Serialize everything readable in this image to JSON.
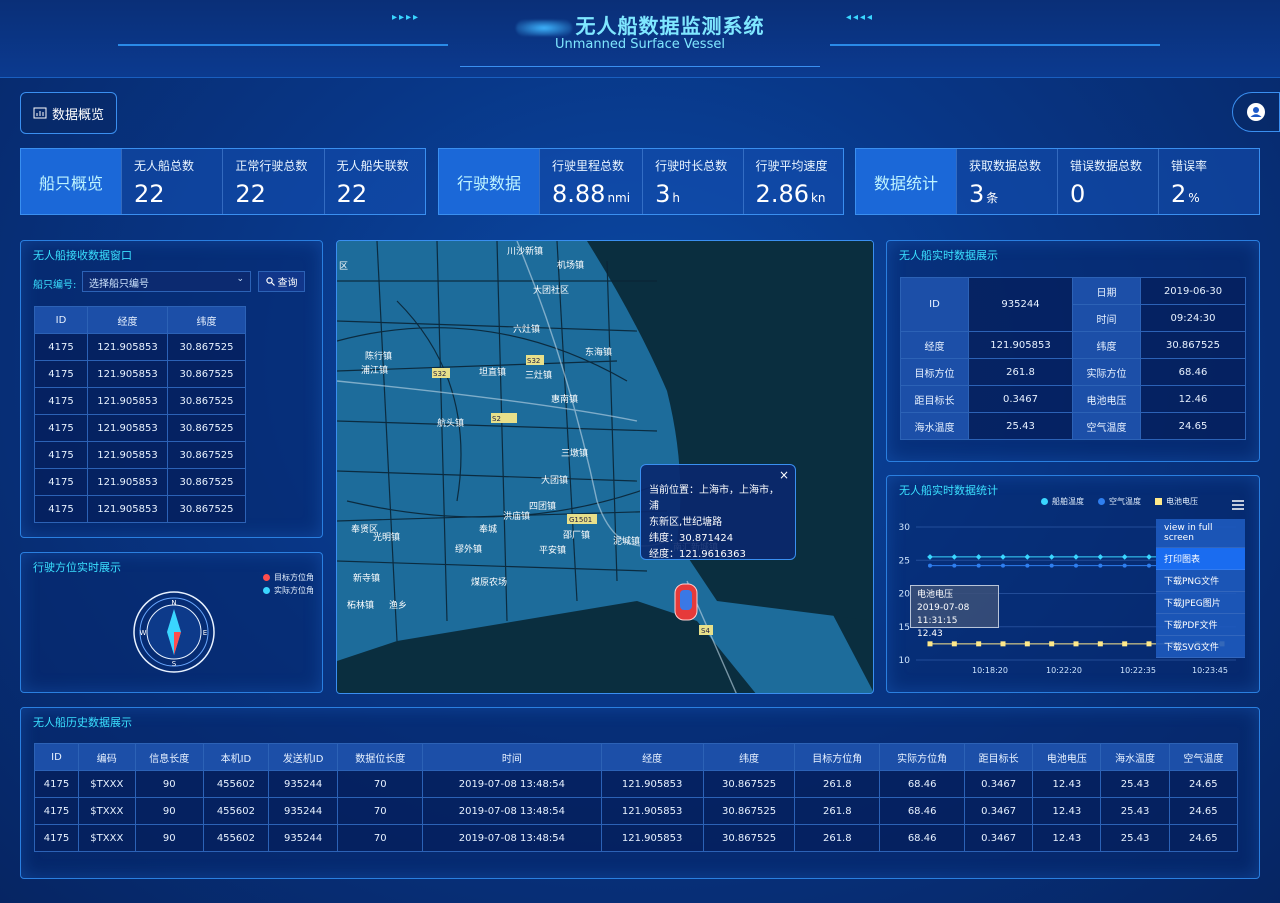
{
  "header": {
    "title": "无人船数据监测系统",
    "subtitle": "Unmanned Surface Vessel",
    "arrows_left": "▸▸▸▸",
    "arrows_right": "◂◂◂◂"
  },
  "nav": {
    "overview_label": "数据概览"
  },
  "stats": [
    {
      "head": "船只概览",
      "cells": [
        {
          "label": "无人船总数",
          "value": "22",
          "unit": ""
        },
        {
          "label": "正常行驶总数",
          "value": "22",
          "unit": ""
        },
        {
          "label": "无人船失联数",
          "value": "22",
          "unit": ""
        }
      ]
    },
    {
      "head": "行驶数据",
      "cells": [
        {
          "label": "行驶里程总数",
          "value": "8.88",
          "unit": "nmi"
        },
        {
          "label": "行驶时长总数",
          "value": "3",
          "unit": "h"
        },
        {
          "label": "行驶平均速度",
          "value": "2.86",
          "unit": "kn"
        }
      ]
    },
    {
      "head": "数据统计",
      "cells": [
        {
          "label": "获取数据总数",
          "value": "3",
          "unit": "条"
        },
        {
          "label": "错误数据总数",
          "value": "0",
          "unit": ""
        },
        {
          "label": "错误率",
          "value": "2",
          "unit": "%"
        }
      ]
    }
  ],
  "receive": {
    "title": "无人船接收数据窗口",
    "ship_label": "船只编号:",
    "select_placeholder": "选择船只编号",
    "query_label": "查询",
    "columns": [
      "ID",
      "经度",
      "纬度"
    ],
    "rows": [
      [
        "4175",
        "121.905853",
        "30.867525"
      ],
      [
        "4175",
        "121.905853",
        "30.867525"
      ],
      [
        "4175",
        "121.905853",
        "30.867525"
      ],
      [
        "4175",
        "121.905853",
        "30.867525"
      ],
      [
        "4175",
        "121.905853",
        "30.867525"
      ],
      [
        "4175",
        "121.905853",
        "30.867525"
      ],
      [
        "4175",
        "121.905853",
        "30.867525"
      ]
    ]
  },
  "compass": {
    "title": "行驶方位实时展示",
    "legend": [
      {
        "label": "目标方位角",
        "color": "#ff4d4d"
      },
      {
        "label": "实际方位角",
        "color": "#3ad6ff"
      }
    ],
    "dirs": {
      "n": "N",
      "s": "S",
      "e": "E",
      "w": "W"
    }
  },
  "map": {
    "popup_line1": "当前位置：上海市，上海市，浦",
    "popup_line2": "东新区,世纪塘路",
    "popup_lat": "纬度：30.871424",
    "popup_lng": "经度：121.9616363",
    "close": "×",
    "places": [
      {
        "name": "川沙新镇"
      },
      {
        "name": "机场镇"
      },
      {
        "name": "大团社区"
      },
      {
        "name": "六灶镇"
      },
      {
        "name": "陈行镇"
      },
      {
        "name": "浦江镇"
      },
      {
        "name": "坦直镇"
      },
      {
        "name": "三灶镇"
      },
      {
        "name": "东海镇"
      },
      {
        "name": "惠南镇"
      },
      {
        "name": "航头镇"
      },
      {
        "name": "三墩镇"
      },
      {
        "name": "大团镇"
      },
      {
        "name": "四团镇"
      },
      {
        "name": "奉贤区"
      },
      {
        "name": "光明镇"
      },
      {
        "name": "洪庙镇"
      },
      {
        "name": "奉城"
      },
      {
        "name": "邵厂镇"
      },
      {
        "name": "泥城镇"
      },
      {
        "name": "缪外镇"
      },
      {
        "name": "平安镇"
      },
      {
        "name": "南汇新城镇"
      },
      {
        "name": "新寺镇"
      },
      {
        "name": "煤原农场"
      },
      {
        "name": "柘林镇"
      },
      {
        "name": "渔乡"
      },
      {
        "name": "区"
      }
    ],
    "road_labels": [
      "S32",
      "G1501",
      "S32",
      "S2",
      "S4"
    ]
  },
  "realtime": {
    "title": "无人船实时数据展示",
    "id_label": "ID",
    "id_value": "935244",
    "date_label": "日期",
    "date_value": "2019-06-30",
    "time_label": "时间",
    "time_value": "09:24:30",
    "rows": [
      [
        "经度",
        "121.905853",
        "纬度",
        "30.867525"
      ],
      [
        "目标方位",
        "261.8",
        "实际方位",
        "68.46"
      ],
      [
        "距目标长",
        "0.3467",
        "电池电压",
        "12.46"
      ],
      [
        "海水温度",
        "25.43",
        "空气温度",
        "24.65"
      ]
    ]
  },
  "stats_chart": {
    "title": "无人船实时数据统计",
    "menu": [
      "view in full screen",
      "打印图表",
      "下载PNG文件",
      "下载JPEG图片",
      "下载PDF文件",
      "下载SVG文件"
    ],
    "tooltip": {
      "name": "电池电压",
      "time": "2019-07-08 11:31:15",
      "value": "12.43"
    }
  },
  "chart_data": {
    "type": "line",
    "yticks": [
      "30",
      "25",
      "20",
      "15",
      "10"
    ],
    "xticks": [
      "10:18:20",
      "10:22:20",
      "10:22:35",
      "10:23:45"
    ],
    "ylim": [
      10,
      30
    ],
    "series": [
      {
        "name": "船舶温度",
        "color": "#3ad6ff",
        "values": [
          25.5,
          25.5,
          25.5,
          25.5,
          25.5,
          25.5,
          25.5,
          25.5,
          25.5,
          25.5,
          25.5,
          25.5,
          25.5
        ]
      },
      {
        "name": "空气温度",
        "color": "#2f7ff0",
        "values": [
          24.2,
          24.2,
          24.2,
          24.2,
          24.2,
          24.2,
          24.2,
          24.2,
          24.2,
          24.2,
          24.2,
          24.2,
          24.2
        ]
      },
      {
        "name": "电池电压",
        "color": "#ffe98a",
        "values": [
          12.43,
          12.43,
          12.43,
          12.43,
          12.43,
          12.43,
          12.43,
          12.43,
          12.43,
          12.43,
          12.43,
          12.43,
          12.43
        ]
      }
    ]
  },
  "history": {
    "title": "无人船历史数据展示",
    "columns": [
      "ID",
      "编码",
      "信息长度",
      "本机ID",
      "发送机ID",
      "数据位长度",
      "时间",
      "经度",
      "纬度",
      "目标方位角",
      "实际方位角",
      "距目标长",
      "电池电压",
      "海水温度",
      "空气温度"
    ],
    "rows": [
      [
        "4175",
        "$TXXX",
        "90",
        "455602",
        "935244",
        "70",
        "2019-07-08 13:48:54",
        "121.905853",
        "30.867525",
        "261.8",
        "68.46",
        "0.3467",
        "12.43",
        "25.43",
        "24.65"
      ],
      [
        "4175",
        "$TXXX",
        "90",
        "455602",
        "935244",
        "70",
        "2019-07-08 13:48:54",
        "121.905853",
        "30.867525",
        "261.8",
        "68.46",
        "0.3467",
        "12.43",
        "25.43",
        "24.65"
      ],
      [
        "4175",
        "$TXXX",
        "90",
        "455602",
        "935244",
        "70",
        "2019-07-08 13:48:54",
        "121.905853",
        "30.867525",
        "261.8",
        "68.46",
        "0.3467",
        "12.43",
        "25.43",
        "24.65"
      ]
    ]
  }
}
